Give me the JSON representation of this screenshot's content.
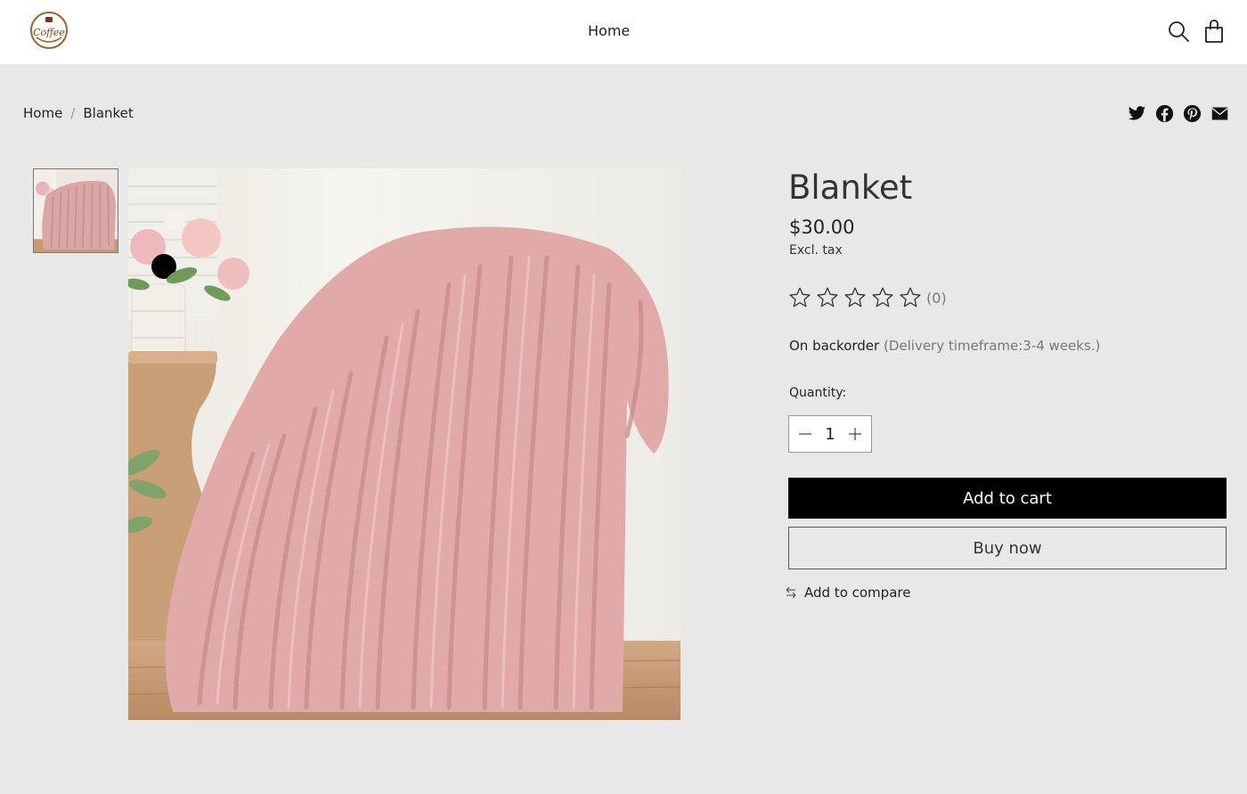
{
  "header": {
    "logo_text": "Coffee",
    "nav_home": "Home"
  },
  "breadcrumb": {
    "home": "Home",
    "separator": "/",
    "current": "Blanket"
  },
  "share": {
    "icons": [
      "twitter-icon",
      "facebook-icon",
      "pinterest-icon",
      "email-icon"
    ]
  },
  "product": {
    "title": "Blanket",
    "price": "$30.00",
    "tax_note": "Excl. tax",
    "rating_count": "(0)",
    "rating_value": 0,
    "rating_max": 5,
    "stock_status": "On backorder",
    "delivery": "(Delivery timeframe:3-4 weeks.)",
    "quantity_label": "Quantity:",
    "quantity": "1",
    "add_to_cart": "Add to cart",
    "buy_now": "Buy now",
    "add_to_compare": "Add to compare"
  },
  "colors": {
    "page_background": "#e8e8e8",
    "primary_button": "#000000",
    "blanket_pink": "#e3a9a9"
  }
}
